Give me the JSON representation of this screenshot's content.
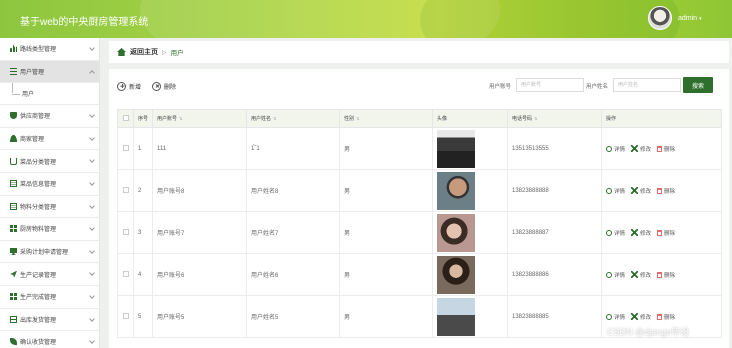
{
  "header": {
    "title": "基于web的中央厨房管理系统",
    "username": "admin"
  },
  "sidebar": {
    "items": [
      {
        "label": "路线类型管理",
        "icon": "bar-chart-icon"
      },
      {
        "label": "用户管理",
        "icon": "list-icon",
        "expanded": true,
        "active": true
      },
      {
        "label": "供应商管理",
        "icon": "shield-icon"
      },
      {
        "label": "商家管理",
        "icon": "user-icon"
      },
      {
        "label": "菜品分类管理",
        "icon": "cart-icon"
      },
      {
        "label": "菜品信息管理",
        "icon": "document-icon"
      },
      {
        "label": "物料分类管理",
        "icon": "document-icon"
      },
      {
        "label": "厨房物料管理",
        "icon": "grid-icon"
      },
      {
        "label": "采购计划申请管理",
        "icon": "monitor-icon"
      },
      {
        "label": "生产记录管理",
        "icon": "plane-icon"
      },
      {
        "label": "生产完成管理",
        "icon": "grid-icon"
      },
      {
        "label": "出库发货管理",
        "icon": "box-icon"
      },
      {
        "label": "确认收货管理",
        "icon": "leaf-icon"
      }
    ],
    "sub_items": [
      "用户"
    ]
  },
  "breadcrumb": {
    "home": "返回主页",
    "current": "用户"
  },
  "toolbar": {
    "add_label": "新增",
    "delete_label": "删除",
    "filter_account_label": "用户账号",
    "filter_account_placeholder": "用户账号",
    "filter_name_label": "用户姓名",
    "filter_name_placeholder": "用户姓名",
    "search_label": "搜索"
  },
  "table": {
    "columns": [
      "序号",
      "用户账号",
      "用户姓名",
      "性别",
      "头像",
      "电话号码",
      "操作"
    ],
    "rows": [
      {
        "index": "1",
        "account": "111",
        "name": "1́ˇ1",
        "gender": "男",
        "phone": "13513513555",
        "photo": "photo-1"
      },
      {
        "index": "2",
        "account": "用户账号8",
        "name": "用户姓名8",
        "gender": "男",
        "phone": "13823888888",
        "photo": "photo-2"
      },
      {
        "index": "3",
        "account": "用户账号7",
        "name": "用户姓名7",
        "gender": "男",
        "phone": "13823888887",
        "photo": "photo-3"
      },
      {
        "index": "4",
        "account": "用户账号6",
        "name": "用户姓名6",
        "gender": "男",
        "phone": "13823888886",
        "photo": "photo-4"
      },
      {
        "index": "5",
        "account": "用户账号5",
        "name": "用户姓名5",
        "gender": "男",
        "phone": "13823888885",
        "photo": "photo-5"
      }
    ],
    "actions": {
      "detail": "详情",
      "edit": "修改",
      "delete": "删除"
    }
  },
  "watermark": "CSDN @django毕设",
  "colors": {
    "primary": "#2e6f2e",
    "header_green": "#a9d344",
    "danger": "#e06b6b"
  }
}
